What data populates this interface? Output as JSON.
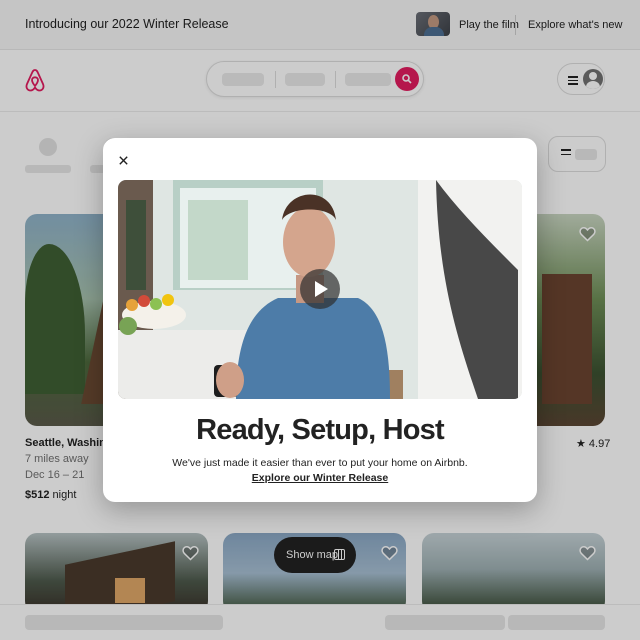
{
  "banner": {
    "intro_text": "Introducing our 2022 Winter Release",
    "play_film_label": "Play the film",
    "explore_new_label": "Explore what's new"
  },
  "header": {
    "logo_icon": "airbnb-logo",
    "search_icon": "search-icon",
    "menu_icon": "hamburger-icon",
    "avatar_icon": "user-avatar-icon",
    "brand_color": "#e31c5f"
  },
  "filters": {
    "icon": "sliders-icon"
  },
  "listings": [
    {
      "title": "Seattle, Washingt",
      "distance": "7 miles away",
      "dates": "Dec 16 – 21",
      "price": "$512",
      "price_suffix": " night"
    },
    {
      "rating": "★ 4.97"
    }
  ],
  "show_map": {
    "label": "Show map",
    "icon": "map-icon"
  },
  "modal": {
    "close_icon": "close-icon",
    "play_icon": "play-icon",
    "title": "Ready, Setup, Host",
    "description": "We've just made it easier than ever to put your home on Airbnb.",
    "link": "Explore our Winter Release"
  }
}
